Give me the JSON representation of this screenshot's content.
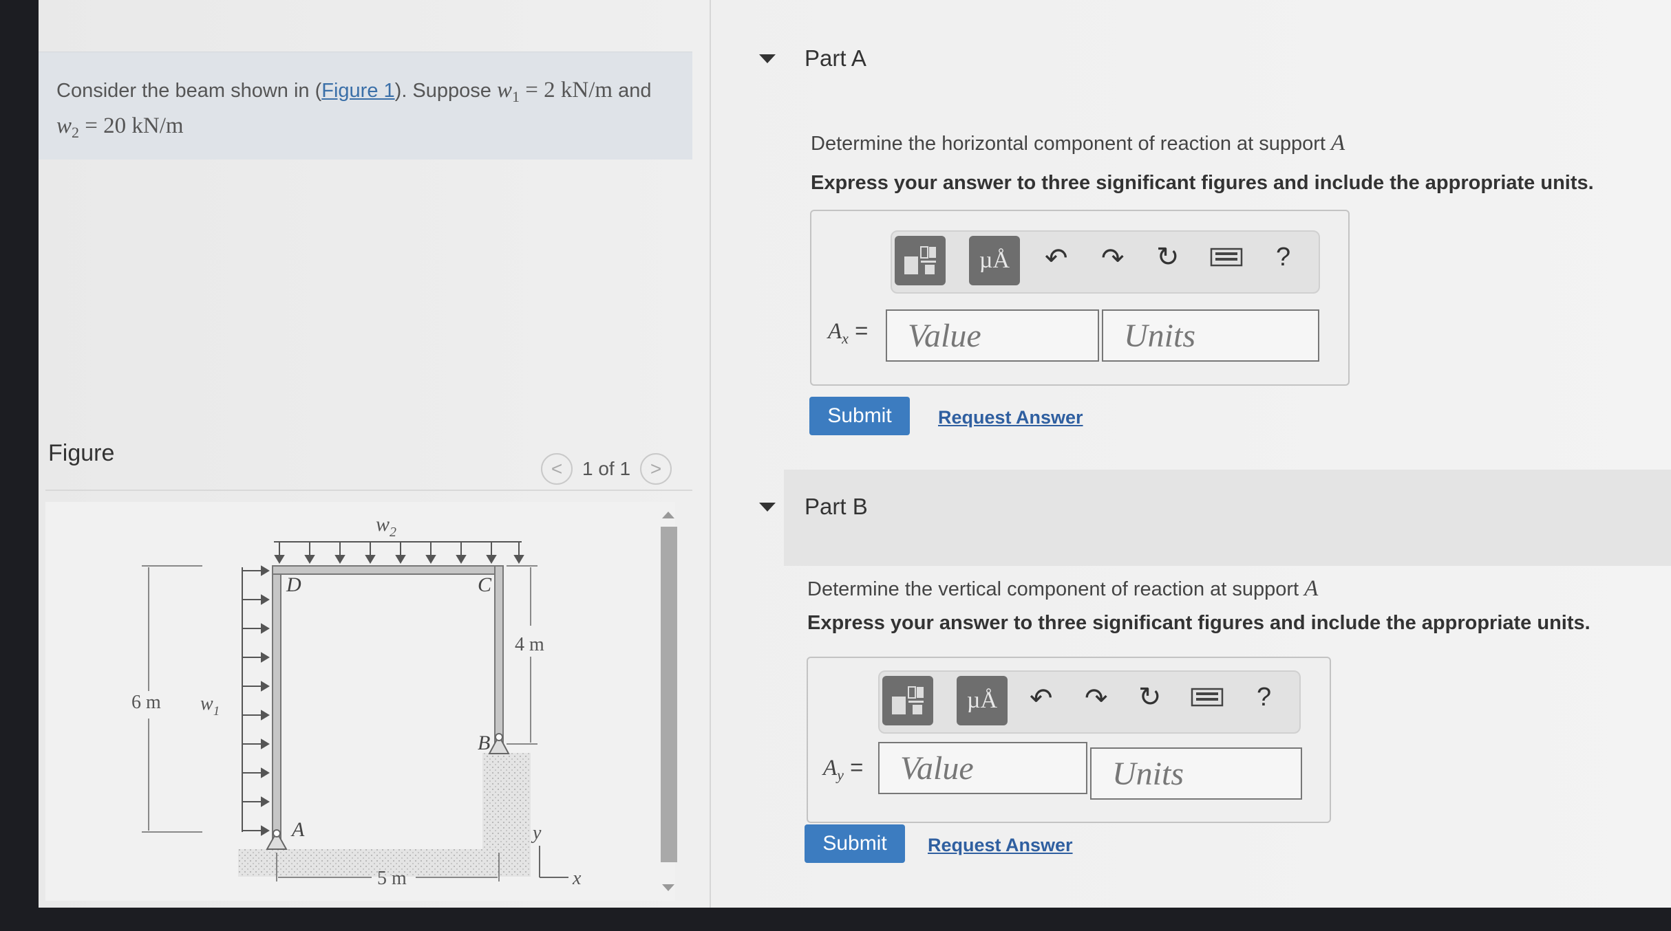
{
  "problem": {
    "text_before_link": "Consider the beam shown in (",
    "link_text": "Figure 1",
    "text_after_link": "). Suppose ",
    "w1_var": "w",
    "w1_sub": "1",
    "w1_value": " = 2 kN/m",
    "and_text": " and",
    "w2_var": "w",
    "w2_sub": "2",
    "w2_value": " = 20 kN/m"
  },
  "figure": {
    "title": "Figure",
    "counter": "1 of 1",
    "prev_label": "<",
    "next_label": ">",
    "labels": {
      "w2": "w",
      "w2_sub": "2",
      "w1": "w",
      "w1_sub": "1",
      "D": "D",
      "C": "C",
      "B": "B",
      "A": "A",
      "dim_4m": "4 m",
      "dim_6m": "6 m",
      "dim_5m": "5 m",
      "axis_x": "x",
      "axis_y": "y"
    }
  },
  "part_a": {
    "title": "Part A",
    "question_text": "Determine the horizontal component of reaction at support ",
    "question_var": "A",
    "instruction": "Express your answer to three significant figures and include the appropriate units.",
    "label_var": "A",
    "label_sub": "x",
    "label_eq": " =",
    "value_placeholder": "Value",
    "units_placeholder": "Units",
    "submit_label": "Submit",
    "request_label": "Request Answer"
  },
  "part_b": {
    "title": "Part B",
    "question_text": "Determine the vertical component of reaction at support ",
    "question_var": "A",
    "instruction": "Express your answer to three significant figures and include the appropriate units.",
    "label_var": "A",
    "label_sub": "y",
    "label_eq": " =",
    "value_placeholder": "Value",
    "units_placeholder": "Units",
    "submit_label": "Submit",
    "request_label": "Request Answer"
  },
  "toolbar": {
    "units_button_label": "µÅ",
    "help_label": "?",
    "icons": [
      "templates-icon",
      "units-icon",
      "undo-icon",
      "redo-icon",
      "reset-icon",
      "keyboard-icon",
      "help-icon"
    ]
  },
  "colors": {
    "accent_button": "#3c7cc0",
    "link": "#2f5fa0",
    "problem_box": "#dfe3e8"
  }
}
